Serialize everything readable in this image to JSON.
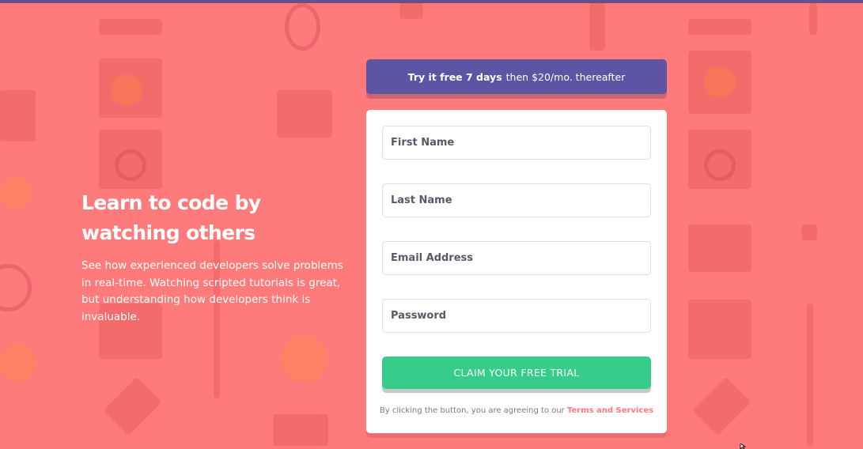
{
  "promo": {
    "strong": "Try it free 7 days",
    "rest": "then $20/mo. thereafter"
  },
  "hero": {
    "title": "Learn to code by watching others",
    "description": "See how experienced developers solve problems in real-time. Watching scripted tutorials is great, but understanding how developers think is invaluable."
  },
  "form": {
    "first_name": {
      "placeholder": "First Name",
      "value": ""
    },
    "last_name": {
      "placeholder": "Last Name",
      "value": ""
    },
    "email": {
      "placeholder": "Email Address",
      "value": ""
    },
    "password": {
      "placeholder": "Password",
      "value": ""
    },
    "submit_label": "CLAIM YOUR FREE TRIAL",
    "terms_prefix": "By clicking the button, you are agreeing to our",
    "terms_link": "Terms and Services"
  },
  "colors": {
    "background": "#ff7a7a",
    "promo": "#5e54a4",
    "button": "#38cc8b",
    "link": "#ff7a7a"
  },
  "icons": [
    "mouse-cursor-icon"
  ]
}
